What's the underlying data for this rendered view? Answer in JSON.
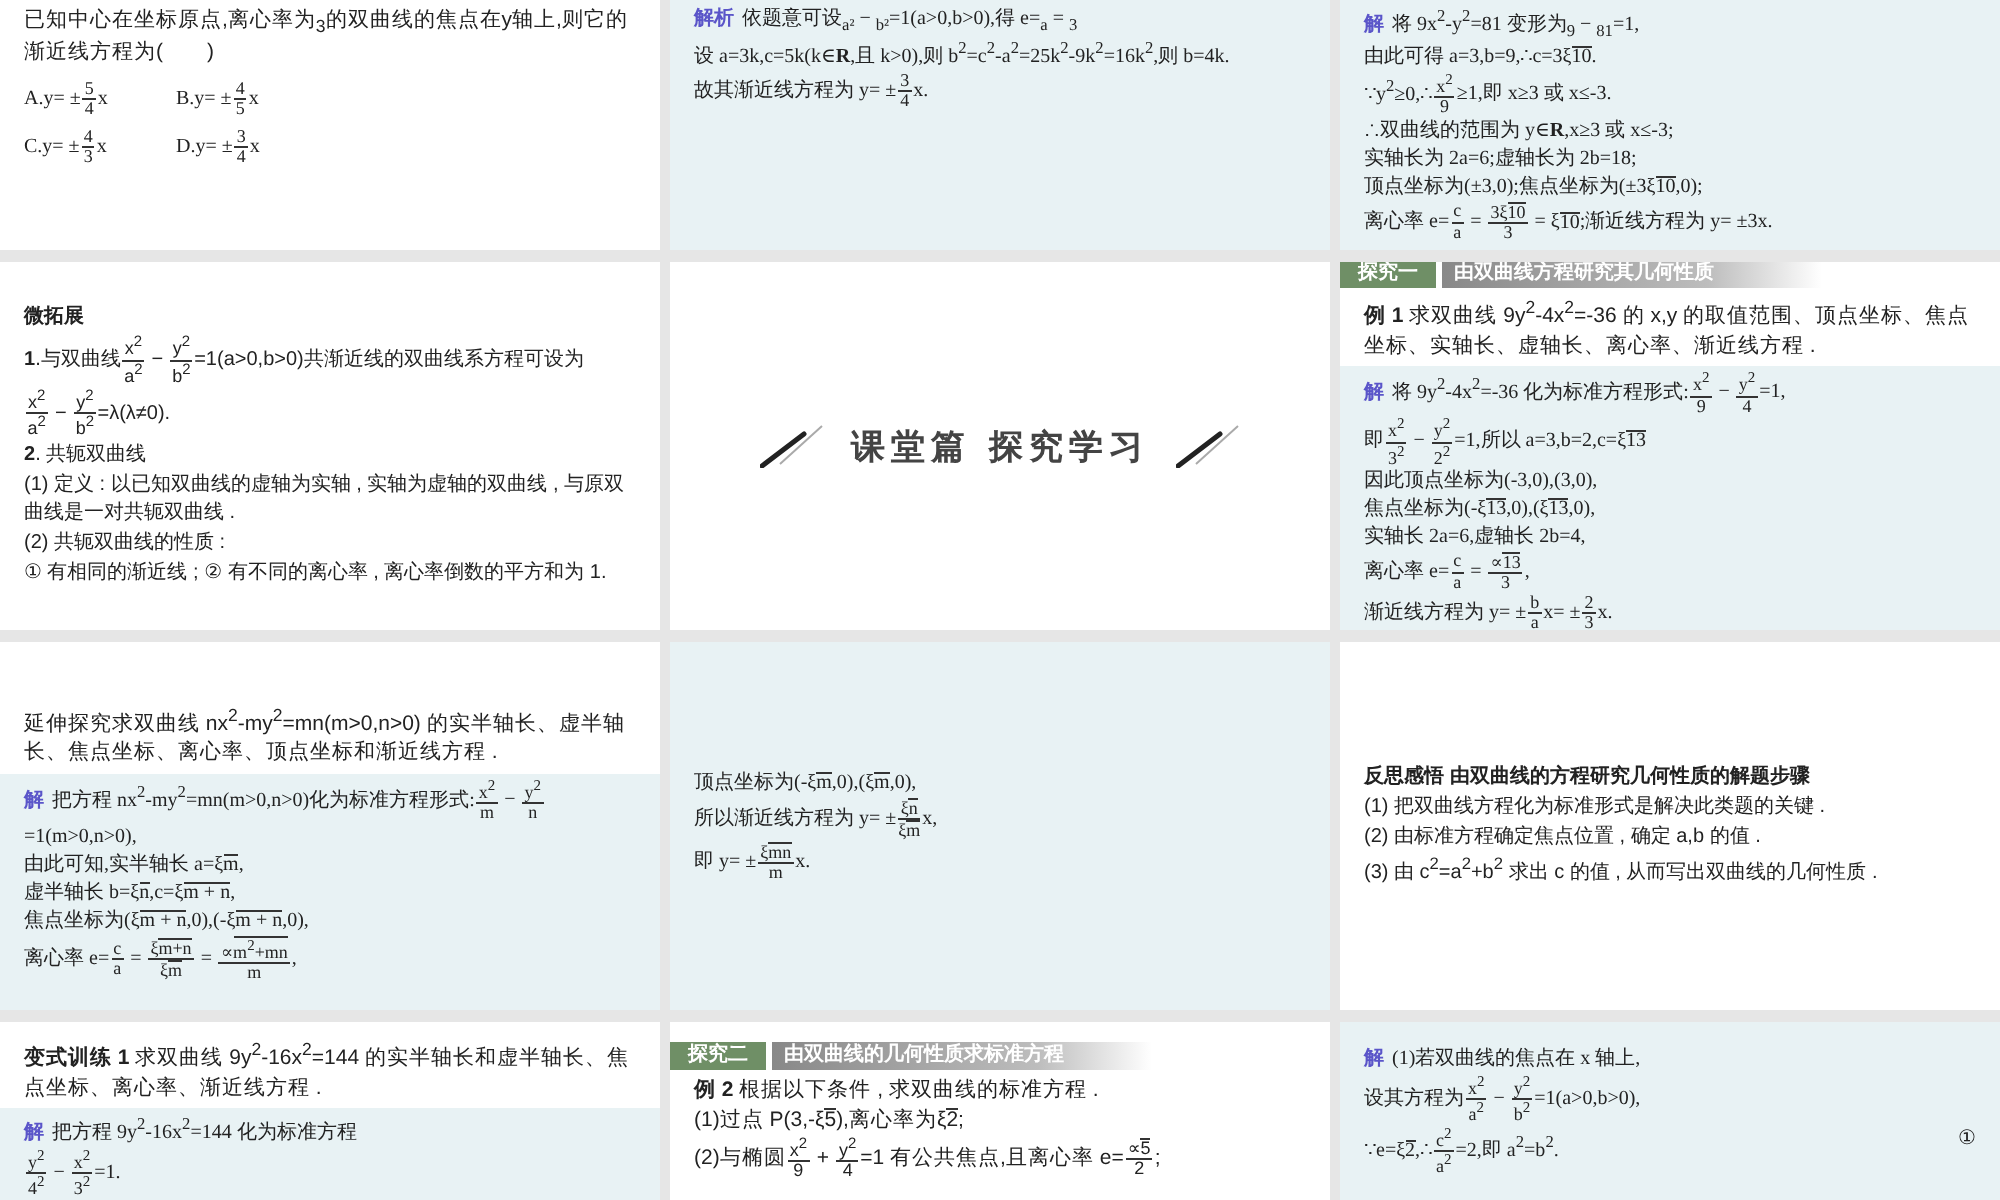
{
  "slides": [
    {
      "kind": "content",
      "sections": [
        {
          "kind": "question",
          "lines": [
            [
              "已知中心在坐标原点,离心率为$_{3}$的双曲线的焦点在y轴上,则它的渐近线方程为(　　)"
            ]
          ]
        },
        {
          "kind": "options",
          "lines": [
            [
              "A.y= ±",
              {
                "frac": [
                  "5",
                  "4"
                ]
              },
              "x"
            ],
            [
              "B.y= ±",
              {
                "frac": [
                  "4",
                  "5"
                ]
              },
              "x"
            ],
            [
              "C.y= ±",
              {
                "frac": [
                  "4",
                  "3"
                ]
              },
              "x"
            ],
            [
              "D.y= ±",
              {
                "frac": [
                  "3",
                  "4"
                ]
              },
              "x"
            ]
          ]
        }
      ]
    },
    {
      "kind": "content",
      "sections": [
        {
          "kind": "solution",
          "lines": [
            [
              {
                "label": "解析"
              },
              "依题意可设$_{a²}$ − $_{b²}$=1(a>0,b>0),得 e=$_{a}$ = $_{3}$"
            ],
            [
              "设 a=3k,c=5k(k∈**R**,且 k>0),则 b$^{2}$=c$^{2}$-a$^{2}$=25k$^{2}$-9k$^{2}$=16k$^{2}$,则 b=4k."
            ],
            [
              "故其渐近线方程为 y= ±",
              {
                "frac": [
                  "3",
                  "4"
                ]
              },
              "x."
            ]
          ]
        }
      ]
    },
    {
      "kind": "content",
      "sections": [
        {
          "kind": "solution",
          "lines": [
            [
              {
                "label": "解"
              },
              "将 9x$^{2}$-y$^{2}$=81 变形为$_{9}$ − $_{81}$=1,"
            ],
            [
              "由此可得 a=3,b=9,∴c=3ξ",
              {
                "over": "10"
              },
              "."
            ],
            [
              "∵y$^{2}$≥0,∴",
              {
                "frac": [
                  "x$^{2}$",
                  "9"
                ]
              },
              "≥1,即 x≥3 或 x≤-3."
            ],
            [
              "∴双曲线的范围为 y∈**R**,x≥3 或 x≤-3;"
            ],
            [
              "实轴长为 2a=6;虚轴长为 2b=18;"
            ],
            [
              "顶点坐标为(±3,0);焦点坐标为(±3ξ",
              {
                "over": "10"
              },
              ",0);"
            ],
            [
              "离心率 e=",
              {
                "frac": [
                  "c",
                  "a"
                ]
              },
              " = ",
              {
                "frac": [
                  [
                    "3ξ",
                    {
                      "over": "10"
                    }
                  ],
                  "3"
                ]
              },
              " = ξ",
              {
                "over": "10"
              },
              ";渐近线方程为 y= ±3x."
            ]
          ]
        }
      ]
    },
    {
      "kind": "content",
      "sections": [
        {
          "kind": "notes",
          "lines": [
            [
              "微拓展"
            ],
            [
              "**1**.与双曲线",
              {
                "frac": [
                  "x$^{2}$",
                  "a$^{2}$"
                ]
              },
              " − ",
              {
                "frac": [
                  "y$^{2}$",
                  "b$^{2}$"
                ]
              },
              "=1(a>0,b>0)共渐近线的双曲线系方程可设为"
            ],
            [
              {
                "frac": [
                  "x$^{2}$",
                  "a$^{2}$"
                ]
              },
              " − ",
              {
                "frac": [
                  "y$^{2}$",
                  "b$^{2}$"
                ]
              },
              "=λ(λ≠0)."
            ],
            [
              "**2**. 共轭双曲线"
            ],
            [
              "(1) 定义 : 以已知双曲线的虚轴为实轴 , 实轴为虚轴的双曲线 , 与原双曲线是一对共轭双曲线 ."
            ],
            [
              "(2) 共轭双曲线的性质 :"
            ],
            [
              "① 有相同的渐近线 ; ② 有不同的离心率 , 离心率倒数的平方和为 1."
            ]
          ]
        }
      ]
    },
    {
      "kind": "title",
      "title": "课堂篇 探究学习"
    },
    {
      "kind": "content",
      "header": {
        "tag": "探究一",
        "title": "由双曲线方程研究其几何性质"
      },
      "sections": [
        {
          "kind": "question",
          "lines": [
            [
              "**例 1** 求双曲线 9y$^{2}$-4x$^{2}$=-36 的 x,y 的取值范围、顶点坐标、焦点坐标、实轴长、虚轴长、离心率、渐近线方程 ."
            ]
          ]
        },
        {
          "kind": "solution",
          "lines": [
            [
              {
                "label": "解"
              },
              "将 9y$^{2}$-4x$^{2}$=-36 化为标准方程形式:",
              {
                "frac": [
                  "x$^{2}$",
                  "9"
                ]
              },
              " − ",
              {
                "frac": [
                  "y$^{2}$",
                  "4"
                ]
              },
              "=1,"
            ],
            [
              "即",
              {
                "frac": [
                  "x$^{2}$",
                  "3$^{2}$"
                ]
              },
              " − ",
              {
                "frac": [
                  "y$^{2}$",
                  "2$^{2}$"
                ]
              },
              "=1,所以 a=3,b=2,c=ξ",
              {
                "over": "13"
              }
            ],
            [
              "因此顶点坐标为(-3,0),(3,0),"
            ],
            [
              "焦点坐标为(-ξ",
              {
                "over": "13"
              },
              ",0),(ξ",
              {
                "over": "13"
              },
              ",0),"
            ],
            [
              "实轴长 2a=6,虚轴长 2b=4,"
            ],
            [
              "离心率 e=",
              {
                "frac": [
                  "c",
                  "a"
                ]
              },
              " = ",
              {
                "frac": [
                  [
                    "∝",
                    {
                      "over": "13"
                    }
                  ],
                  "3"
                ]
              },
              ","
            ],
            [
              "渐近线方程为 y= ±",
              {
                "frac": [
                  "b",
                  "a"
                ]
              },
              "x= ±",
              {
                "frac": [
                  "2",
                  "3"
                ]
              },
              "x."
            ]
          ]
        }
      ]
    },
    {
      "kind": "content",
      "sections": [
        {
          "kind": "question",
          "lines": [
            [
              "延伸探究求双曲线 nx$^{2}$-my$^{2}$=mn(m>0,n>0) 的实半轴长、虚半轴长、焦点坐标、离心率、顶点坐标和渐近线方程 ."
            ]
          ]
        },
        {
          "kind": "solution",
          "lines": [
            [
              {
                "label": "解"
              },
              "把方程 nx$^{2}$-my$^{2}$=mn(m>0,n>0)化为标准方程形式:",
              {
                "frac": [
                  "x$^{2}$",
                  "m"
                ]
              },
              " − ",
              {
                "frac": [
                  "y$^{2}$",
                  "n"
                ]
              },
              "=1(m>0,n>0),"
            ],
            [
              "由此可知,实半轴长 a=ξ",
              {
                "over": "m"
              },
              ","
            ],
            [
              "虚半轴长 b=ξ",
              {
                "over": "n"
              },
              ",c=ξ",
              {
                "over": "m + n"
              },
              ","
            ],
            [
              "焦点坐标为(ξ",
              {
                "over": "m + n"
              },
              ",0),(-ξ",
              {
                "over": "m + n"
              },
              ",0),"
            ],
            [
              "离心率 e=",
              {
                "frac": [
                  "c",
                  "a"
                ]
              },
              " = ",
              {
                "frac": [
                  [
                    "ξ",
                    {
                      "over": "m+n"
                    }
                  ],
                  [
                    "ξ",
                    {
                      "over": "m"
                    }
                  ]
                ]
              },
              " = ",
              {
                "frac": [
                  [
                    "∝",
                    {
                      "over": "m$^{2}$+mn"
                    }
                  ],
                  "m"
                ]
              },
              ","
            ]
          ]
        }
      ]
    },
    {
      "kind": "content",
      "sections": [
        {
          "kind": "solution",
          "lines": [
            [
              "顶点坐标为(-ξ",
              {
                "over": "m"
              },
              ",0),(ξ",
              {
                "over": "m"
              },
              ",0),"
            ],
            [
              "所以渐近线方程为 y= ±",
              {
                "frac": [
                  [
                    "ξ",
                    {
                      "over": "n"
                    }
                  ],
                  [
                    "ξ",
                    {
                      "over": "m"
                    }
                  ]
                ]
              },
              "x,"
            ],
            [
              "即 y= ±",
              {
                "frac": [
                  [
                    "ξ",
                    {
                      "over": "mn"
                    }
                  ],
                  "m"
                ]
              },
              "x."
            ]
          ]
        }
      ]
    },
    {
      "kind": "content",
      "sections": [
        {
          "kind": "notes",
          "lines": [
            [
              "反思感悟 由双曲线的方程研究几何性质的解题步骤"
            ],
            [
              "(1) 把双曲线方程化为标准形式是解决此类题的关键 ."
            ],
            [
              "(2) 由标准方程确定焦点位置 , 确定 a,b 的值 ."
            ],
            [
              "(3) 由 c$^{2}$=a$^{2}$+b$^{2}$ 求出 c 的值 , 从而写出双曲线的几何性质 ."
            ]
          ]
        }
      ]
    },
    {
      "kind": "content",
      "sections": [
        {
          "kind": "question",
          "lines": [
            [
              "**变式训练 1** 求双曲线 9y$^{2}$-16x$^{2}$=144 的实半轴长和虚半轴长、焦点坐标、离心率、渐近线方程 ."
            ]
          ]
        },
        {
          "kind": "solution",
          "lines": [
            [
              {
                "label": "解"
              },
              "把方程 9y$^{2}$-16x$^{2}$=144 化为标准方程"
            ],
            [
              {
                "frac": [
                  "y$^{2}$",
                  "4$^{2}$"
                ]
              },
              " − ",
              {
                "frac": [
                  "x$^{2}$",
                  "3$^{2}$"
                ]
              },
              "=1."
            ]
          ]
        }
      ]
    },
    {
      "kind": "content",
      "header": {
        "tag": "探究二",
        "title": "由双曲线的几何性质求标准方程"
      },
      "sections": [
        {
          "kind": "question",
          "lines": [
            [
              "**例 2** 根据以下条件 , 求双曲线的标准方程 ."
            ],
            [
              "(1)过点 P(3,-ξ",
              {
                "over": "5"
              },
              "),离心率为ξ",
              {
                "over": "2"
              },
              ";"
            ],
            [
              "(2)与椭圆",
              {
                "frac": [
                  "x$^{2}$",
                  "9"
                ]
              },
              " + ",
              {
                "frac": [
                  "y$^{2}$",
                  "4"
                ]
              },
              "=1 有公共焦点,且离心率 e=",
              {
                "frac": [
                  [
                    "∝",
                    {
                      "over": "5"
                    }
                  ],
                  "2"
                ]
              },
              ";"
            ]
          ]
        }
      ]
    },
    {
      "kind": "content",
      "sections": [
        {
          "kind": "solution",
          "lines": [
            [
              {
                "label": "解"
              },
              "(1)若双曲线的焦点在 x 轴上,"
            ],
            [
              "设其方程为",
              {
                "frac": [
                  "x$^{2}$",
                  "a$^{2}$"
                ]
              },
              " − ",
              {
                "frac": [
                  "y$^{2}$",
                  "b$^{2}$"
                ]
              },
              "=1(a>0,b>0),"
            ],
            [
              "∵e=ξ",
              {
                "over": "2"
              },
              ",∴",
              {
                "frac": [
                  "c$^{2}$",
                  "a$^{2}$"
                ]
              },
              "=2,即 a$^{2}$=b$^{2}$.",
              {
                "eqno": "①"
              }
            ]
          ]
        }
      ]
    }
  ]
}
